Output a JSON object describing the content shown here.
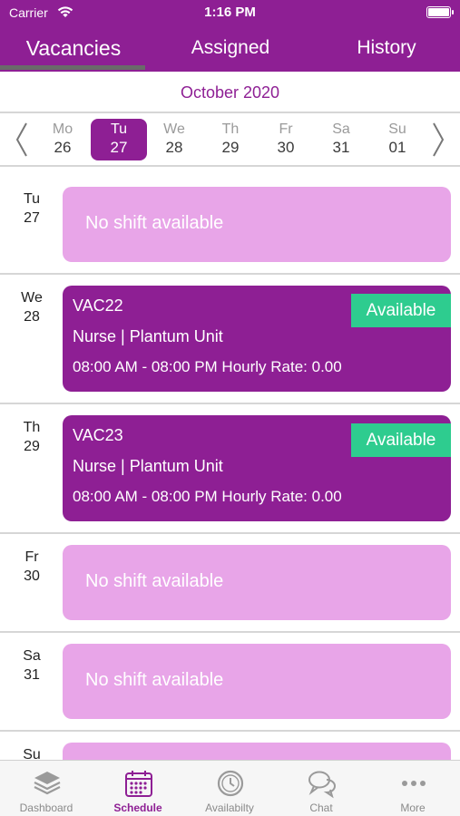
{
  "status_bar": {
    "carrier": "Carrier",
    "time": "1:16 PM"
  },
  "tabs": [
    {
      "label": "Vacancies",
      "active": true
    },
    {
      "label": "Assigned",
      "active": false
    },
    {
      "label": "History",
      "active": false
    }
  ],
  "month_label": "October 2020",
  "week": [
    {
      "name": "Mo",
      "date": "26",
      "selected": false
    },
    {
      "name": "Tu",
      "date": "27",
      "selected": true
    },
    {
      "name": "We",
      "date": "28",
      "selected": false
    },
    {
      "name": "Th",
      "date": "29",
      "selected": false
    },
    {
      "name": "Fr",
      "date": "30",
      "selected": false
    },
    {
      "name": "Sa",
      "date": "31",
      "selected": false
    },
    {
      "name": "Su",
      "date": "01",
      "selected": false
    }
  ],
  "schedule": [
    {
      "day_name": "Tu",
      "day_num": "27",
      "empty_text": "No shift available"
    },
    {
      "day_name": "We",
      "day_num": "28",
      "code": "VAC22",
      "role": "Nurse | Plantum Unit",
      "time": "08:00 AM - 08:00 PM  Hourly Rate: 0.00",
      "badge": "Available"
    },
    {
      "day_name": "Th",
      "day_num": "29",
      "code": "VAC23",
      "role": "Nurse | Plantum Unit",
      "time": "08:00 AM - 08:00 PM  Hourly Rate: 0.00",
      "badge": "Available"
    },
    {
      "day_name": "Fr",
      "day_num": "30",
      "empty_text": "No shift available"
    },
    {
      "day_name": "Sa",
      "day_num": "31",
      "empty_text": "No shift available"
    },
    {
      "day_name": "Su",
      "day_num": ""
    }
  ],
  "bottom_nav": [
    {
      "label": "Dashboard",
      "icon": "layers-icon",
      "active": false
    },
    {
      "label": "Schedule",
      "icon": "calendar-icon",
      "active": true
    },
    {
      "label": "Availabilty",
      "icon": "clock-icon",
      "active": false
    },
    {
      "label": "Chat",
      "icon": "chat-icon",
      "active": false
    },
    {
      "label": "More",
      "icon": "more-icon",
      "active": false
    }
  ],
  "colors": {
    "brand": "#8e1f94",
    "empty_card": "#e8a5e8",
    "available_badge": "#2ecc8f"
  }
}
